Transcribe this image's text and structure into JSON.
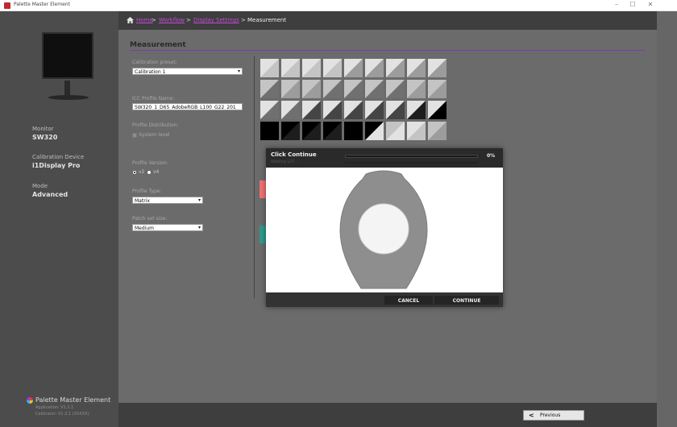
{
  "window": {
    "title": "Palette Master Element",
    "controls": [
      "–",
      "☐",
      "✕"
    ]
  },
  "sidebar": {
    "monitor_label": "Monitor",
    "monitor_value": "SW320",
    "device_label": "Calibration Device",
    "device_value": "i1Display Pro",
    "mode_label": "Mode",
    "mode_value": "Advanced",
    "brand": "Palette Master Element",
    "app_version": "Application: V1.2.1",
    "calibrator_version": "Calibrator: V1.2.1 (XXXXX)"
  },
  "breadcrumb": {
    "home": "Home",
    "workflow": "Workflow",
    "display_settings": "Display Settings",
    "separator": ">",
    "current": "Measurement"
  },
  "section": {
    "title": "Measurement"
  },
  "form": {
    "calibration_preset_label": "Calibration preset:",
    "calibration_preset_value": "Calibration 1",
    "icc_label": "ICC Profile Name:",
    "icc_value": "SW320_1_D65_AdobeRGB_L100_G22_201",
    "distribution_label": "Profile Distribution:",
    "system_level_label": "System level",
    "profile_version_label": "Profile Version:",
    "v2_label": "v2",
    "v4_label": "v4",
    "profile_type_label": "Profile Type:",
    "profile_type_value": "Matrix",
    "patch_size_label": "Patch set size:",
    "patch_size_value": "Medium"
  },
  "patch_colors": [
    "#e2e2e2",
    "#c4c4c4",
    "#9c9c9c",
    "#707070",
    "#454545",
    "#1d1d1d",
    "#000000"
  ],
  "side_swatches": [
    "#ef7171",
    "#2e9a8c"
  ],
  "dialog": {
    "title": "Click Continue",
    "subtitle": "Waiting LUT...",
    "percent": "0%",
    "progress": 0,
    "cancel": "CANCEL",
    "continue": "CONTINUE"
  },
  "footer": {
    "previous": "Previous"
  },
  "colors": {
    "accent": "#7d3cb0",
    "link": "#c44bd8",
    "progress": "#3aa53a"
  }
}
